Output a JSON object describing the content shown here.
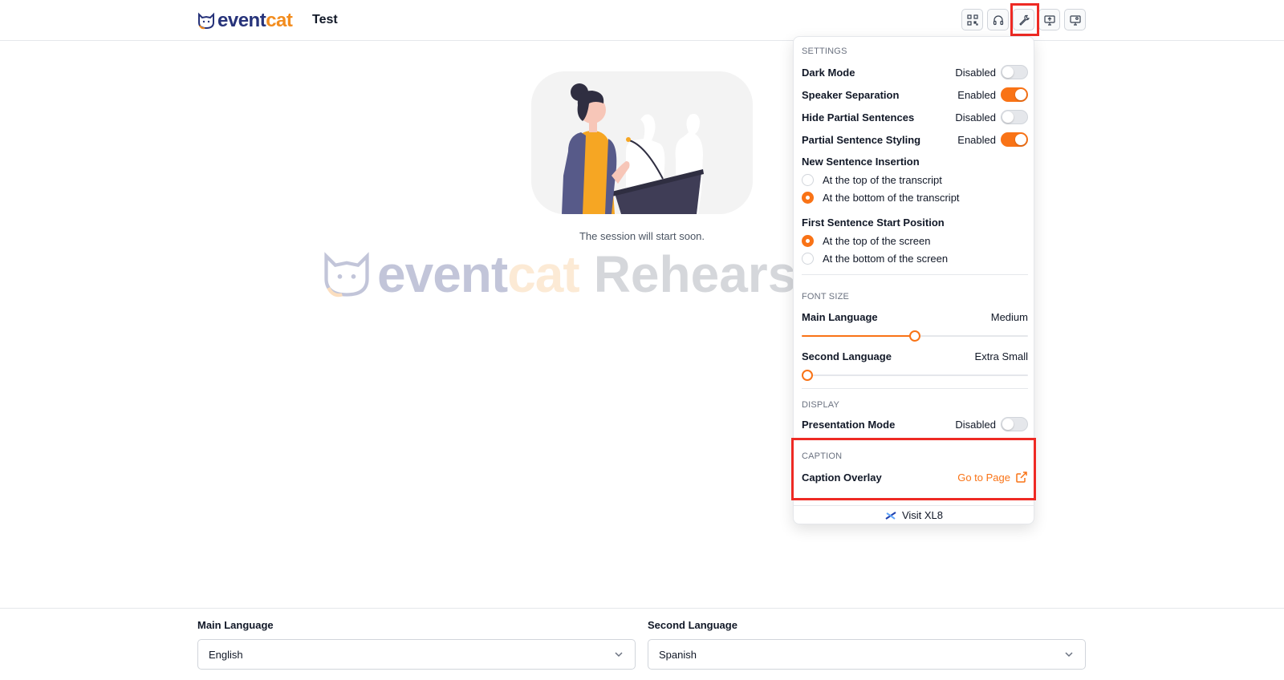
{
  "header": {
    "brand_part1": "event",
    "brand_part2": "cat",
    "session_name": "Test",
    "toolbar": [
      {
        "icon": "qr-code-icon"
      },
      {
        "icon": "headphones-icon"
      },
      {
        "icon": "wrench-icon",
        "active": true
      },
      {
        "icon": "monitor-upload-icon"
      },
      {
        "icon": "monitor-user-icon"
      }
    ]
  },
  "main": {
    "status_text": "The session will start soon.",
    "watermark": {
      "part1": "event",
      "part2": "cat",
      "part3": "Rehears"
    }
  },
  "settings_panel": {
    "settings_title": "SETTINGS",
    "toggles": [
      {
        "label": "Dark Mode",
        "state": "Disabled",
        "on": false
      },
      {
        "label": "Speaker Separation",
        "state": "Enabled",
        "on": true
      },
      {
        "label": "Hide Partial Sentences",
        "state": "Disabled",
        "on": false
      },
      {
        "label": "Partial Sentence Styling",
        "state": "Enabled",
        "on": true
      }
    ],
    "insertion": {
      "title": "New Sentence Insertion",
      "options": [
        {
          "label": "At the top of the transcript",
          "checked": false
        },
        {
          "label": "At the bottom of the transcript",
          "checked": true
        }
      ]
    },
    "start_position": {
      "title": "First Sentence Start Position",
      "options": [
        {
          "label": "At the top of the screen",
          "checked": true
        },
        {
          "label": "At the bottom of the screen",
          "checked": false
        }
      ]
    },
    "font_size_title": "FONT SIZE",
    "main_language": {
      "label": "Main Language",
      "value": "Medium",
      "level": 0.5
    },
    "second_language": {
      "label": "Second Language",
      "value": "Extra Small",
      "level": 0.0
    },
    "display_title": "DISPLAY",
    "presentation_mode": {
      "label": "Presentation Mode",
      "state": "Disabled",
      "on": false
    },
    "caption_title": "CAPTION",
    "caption_overlay": {
      "label": "Caption Overlay",
      "link": "Go to Page"
    },
    "visit": "Visit XL8"
  },
  "footer": {
    "main_language_label": "Main Language",
    "main_language_value": "English",
    "second_language_label": "Second Language",
    "second_language_value": "Spanish"
  },
  "colors": {
    "accent": "#f97316",
    "brand_navy": "#27337a",
    "brand_orange": "#f28c1e",
    "highlight": "#ee2a24"
  }
}
